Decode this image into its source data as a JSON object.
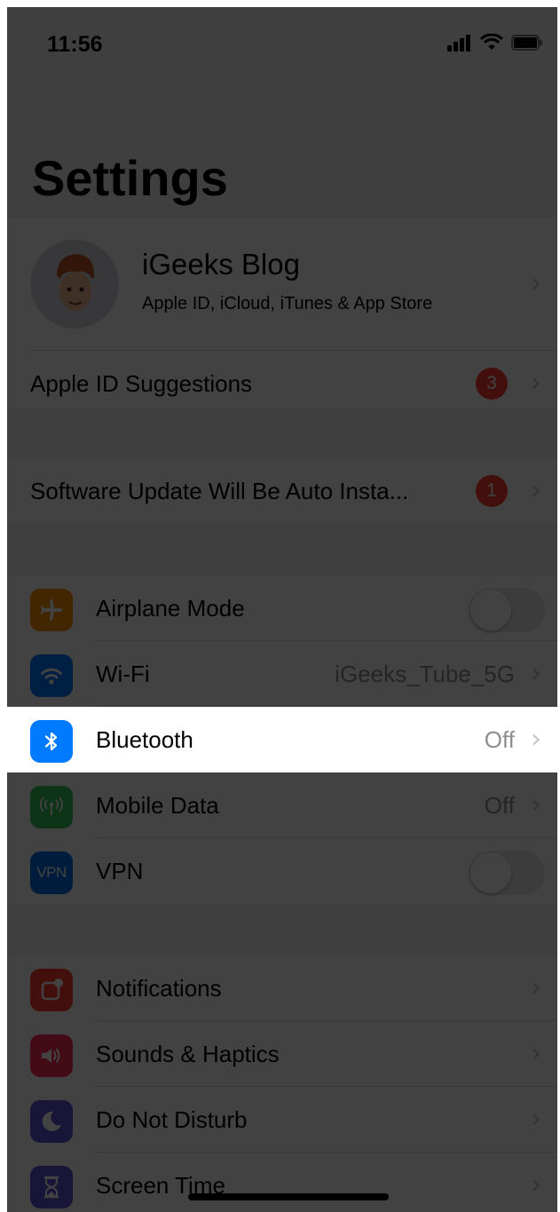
{
  "status_bar": {
    "time": "11:56"
  },
  "page_title": "Settings",
  "profile": {
    "name": "iGeeks Blog",
    "subtitle": "Apple ID, iCloud, iTunes & App Store"
  },
  "apple_id_suggestions": {
    "label": "Apple ID Suggestions",
    "badge": "3"
  },
  "software_update": {
    "label": "Software Update Will Be Auto Insta...",
    "badge": "1"
  },
  "connectivity": {
    "airplane_mode": {
      "label": "Airplane Mode",
      "toggle": "off",
      "icon": "airplane-icon"
    },
    "wifi": {
      "label": "Wi-Fi",
      "value": "iGeeks_Tube_5G",
      "icon": "wifi-icon"
    },
    "bluetooth": {
      "label": "Bluetooth",
      "value": "Off",
      "icon": "bluetooth-icon"
    },
    "mobile_data": {
      "label": "Mobile Data",
      "value": "Off",
      "icon": "antenna-icon"
    },
    "vpn": {
      "label": "VPN",
      "icon_text": "VPN",
      "toggle": "off"
    }
  },
  "general": {
    "notifications": {
      "label": "Notifications",
      "icon": "notifications-icon"
    },
    "sounds": {
      "label": "Sounds & Haptics",
      "icon": "speaker-icon"
    },
    "dnd": {
      "label": "Do Not Disturb",
      "icon": "moon-icon"
    },
    "screen_time": {
      "label": "Screen Time",
      "icon": "hourglass-icon"
    }
  },
  "colors": {
    "airplane": "#ff9500",
    "wifi": "#007aff",
    "bluetooth": "#007aff",
    "mobile_data": "#34c759",
    "vpn": "#006ee6",
    "notifications": "#ff3b30",
    "sounds": "#ff2d55",
    "dnd": "#5856d6",
    "screen_time": "#5856d6",
    "badge": "#ff3b30"
  }
}
